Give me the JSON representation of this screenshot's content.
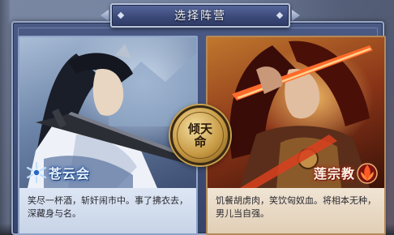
{
  "dialog": {
    "title": "选择阵营"
  },
  "center_seal": {
    "text_line1": "倾天",
    "text_line2": "命"
  },
  "factions": [
    {
      "name": "苍云会",
      "description": "笑尽一杯酒，斩奸闹市中。事了拂衣去，深藏身与名。",
      "emblem": "snowflake-emblem-icon",
      "theme_color": "#2a68c4"
    },
    {
      "name": "莲宗教",
      "description": "饥餐胡虏肉，笑饮匈奴血。将相本无种，男儿当自强。",
      "emblem": "lotus-flame-emblem-icon",
      "theme_color": "#c2301e"
    }
  ]
}
